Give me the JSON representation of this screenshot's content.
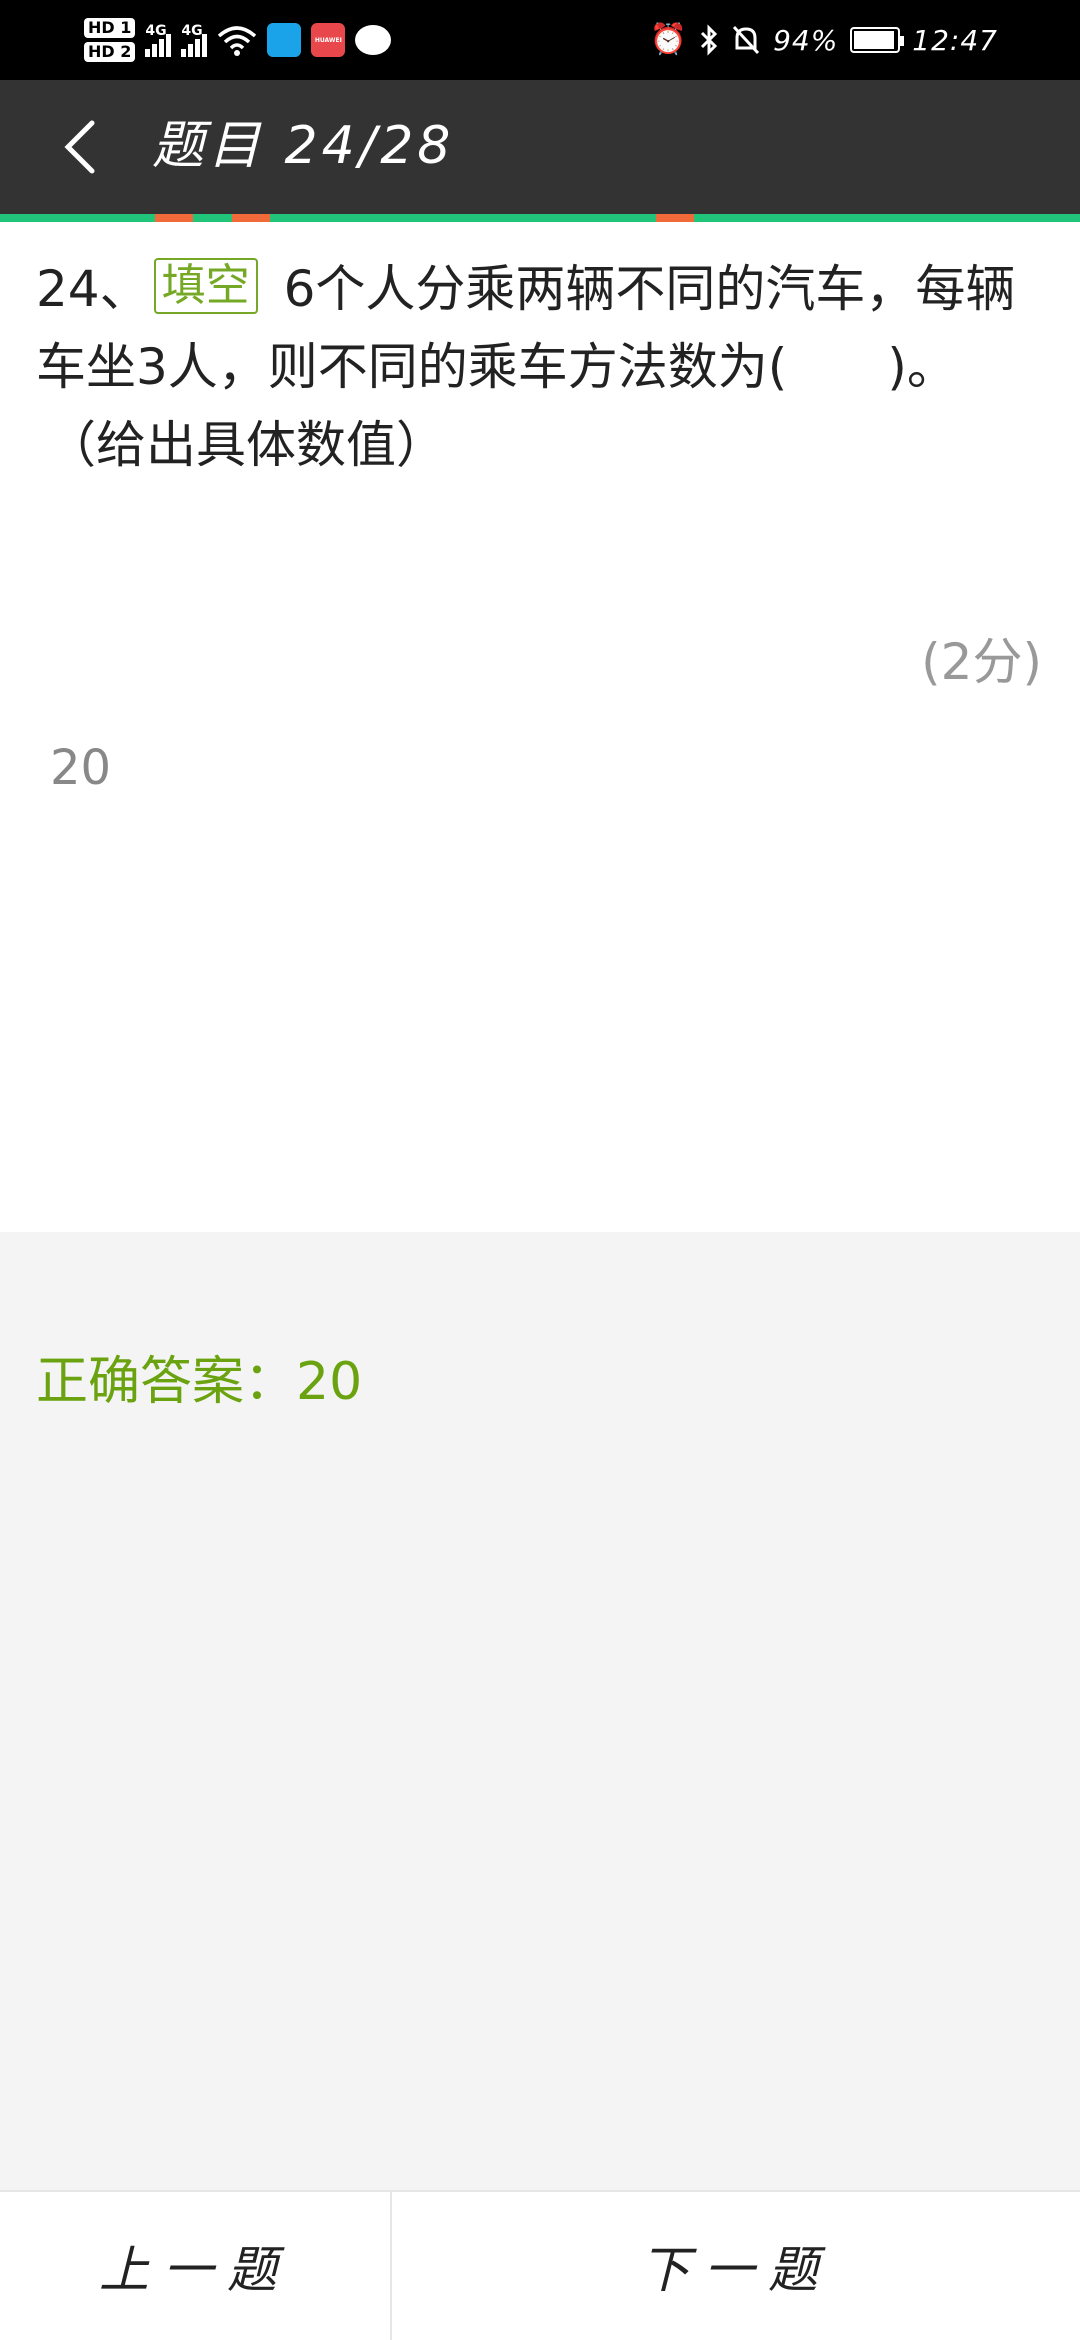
{
  "status_bar": {
    "hd1": "HD 1",
    "hd2": "HD 2",
    "net1": "4G",
    "net2": "4G",
    "huawei_icon_text": "HUAWEI",
    "battery": "94%",
    "time": "12:47",
    "icons": [
      "wifi-icon",
      "book-app-icon",
      "huawei-appgallery-icon",
      "chat-bubble-icon",
      "alarm-icon",
      "bluetooth-icon",
      "mute-bell-icon",
      "battery-icon"
    ]
  },
  "header": {
    "title": "题目 24/28"
  },
  "question": {
    "number": "24、",
    "tag": "填空",
    "text": "6个人分乘两辆不同的汽车，每辆车坐3人，则不同的乘车方法数为(　　)。",
    "note": "（给出具体数值）",
    "score": "(2分)",
    "answer_value": "20"
  },
  "result": {
    "correct_answer": "正确答案：20"
  },
  "footer": {
    "prev_label": "上一题",
    "next_label": "下一题"
  },
  "colors": {
    "status_bar_bg": "#000000",
    "header_bg": "#333333",
    "progress_bar": "#21c57a",
    "progress_mark": "#f26a3a",
    "tag_green": "#75a824",
    "correct_answer_green": "#6aa30f",
    "panel_bg": "#f4f4f4"
  }
}
